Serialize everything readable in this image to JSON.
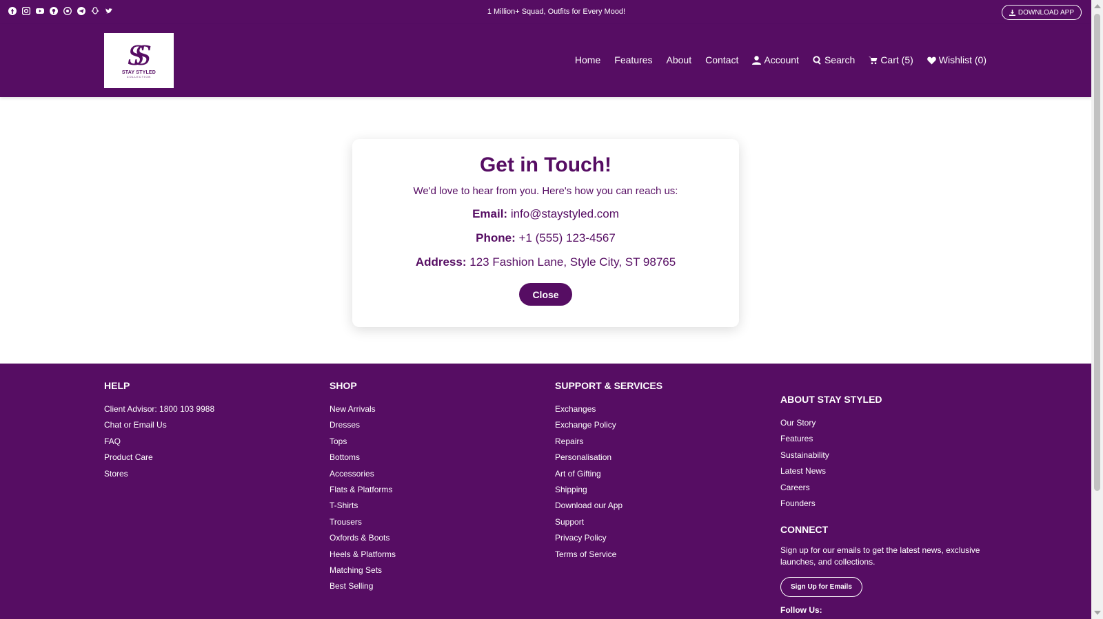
{
  "topbar": {
    "social_icons": [
      "facebook-icon",
      "instagram-icon",
      "youtube-icon",
      "pinterest-icon",
      "whatsapp-icon",
      "telegram-icon",
      "snapchat-icon",
      "twitter-icon"
    ],
    "promo": "1 Million+ Squad, Outfits for Every Mood!",
    "download_label": "DOWNLOAD APP"
  },
  "header": {
    "logo_mark": "SS",
    "logo_text": "STAY STYLED",
    "logo_sub": "COLLECTION",
    "nav": {
      "home": "Home",
      "features": "Features",
      "about": "About",
      "contact": "Contact",
      "account": "Account",
      "search": "Search",
      "cart": "Cart (5)",
      "wishlist": "Wishlist (0)"
    }
  },
  "modal": {
    "title": "Get in Touch!",
    "intro": "We'd love to hear from you. Here's how you can reach us:",
    "email_label": "Email:",
    "email": "info@staystyled.com",
    "phone_label": "Phone:",
    "phone": "+1 (555) 123-4567",
    "address_label": "Address:",
    "address": "123 Fashion Lane, Style City, ST 98765",
    "close_label": "Close"
  },
  "footer": {
    "help": {
      "title": "HELP",
      "items": [
        "Client Advisor: 1800 103 9988",
        "Chat or Email Us",
        "FAQ",
        "Product Care",
        "Stores"
      ]
    },
    "shop": {
      "title": "SHOP",
      "items": [
        "New Arrivals",
        "Dresses",
        "Tops",
        "Bottoms",
        "Accessories",
        "Flats & Platforms",
        "T-Shirts",
        "Trousers",
        "Oxfords & Boots",
        "Heels & Platforms",
        "Matching Sets",
        "Best Selling"
      ]
    },
    "support": {
      "title": "SUPPORT & SERVICES",
      "items": [
        "Exchanges",
        "Exchange Policy",
        "Repairs",
        "Personalisation",
        "Art of Gifting",
        "Shipping",
        "Download our App",
        "Support",
        "Privacy Policy",
        "Terms of Service"
      ]
    },
    "about": {
      "title": "ABOUT STAY STYLED",
      "items": [
        "Our Story",
        "Features",
        "Sustainability",
        "Latest News",
        "Careers",
        "Founders"
      ]
    },
    "connect": {
      "title": "CONNECT",
      "text": "Sign up for our emails to get the latest news, exclusive launches, and collections.",
      "signup_label": "Sign Up for Emails",
      "follow_label": "Follow Us:"
    }
  },
  "colors": {
    "brand": "#560d63",
    "text_on_brand": "#ffffff"
  }
}
